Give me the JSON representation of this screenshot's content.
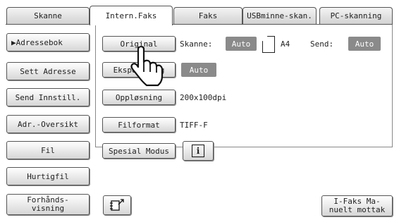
{
  "tabs": [
    {
      "label": "Skanne"
    },
    {
      "label": "Intern.Faks"
    },
    {
      "label": "Faks"
    },
    {
      "label": "USBminne-skan."
    },
    {
      "label": "PC-skanning"
    }
  ],
  "sidebar": {
    "selected_marker": "▶",
    "items": [
      {
        "label": "Adressebok"
      },
      {
        "label": "Sett Adresse"
      },
      {
        "label": "Send Innstill."
      },
      {
        "label": "Adr.-Oversikt"
      },
      {
        "label": "Fil"
      },
      {
        "label": "Hurtigfil"
      },
      {
        "line1": "Forhånds-",
        "line2": "visning"
      }
    ]
  },
  "settings": {
    "original_button": "Original",
    "scan_label": "Skanne:",
    "scan_value": "Auto",
    "paper_size": "A4",
    "send_label": "Send:",
    "send_value": "Auto",
    "exposure_button": "Eksponering",
    "exposure_value": "Auto",
    "resolution_button": "Oppløsning",
    "resolution_value": "200x100dpi",
    "format_button": "Filformat",
    "format_value": "TIFF-F",
    "special_button": "Spesial Modus",
    "info_icon": "i"
  },
  "bottom": {
    "manual_receive_line1": "I-Faks Ma-",
    "manual_receive_line2": "nuelt mottak"
  },
  "icons": {
    "pointer": "hand-pointer-icon",
    "address_book": "address-book-icon"
  },
  "colors": {
    "value_box": "#8a8a8a",
    "frame": "#555555"
  }
}
